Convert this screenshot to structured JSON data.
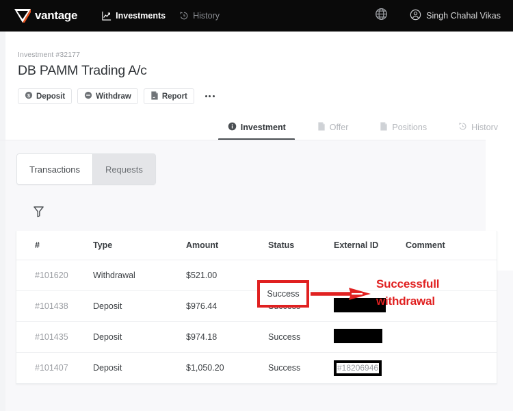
{
  "brand": {
    "name": "vantage",
    "logo_icon": "vantage-v-mark",
    "accent": "#e8531f"
  },
  "topnav": {
    "links": [
      {
        "label": "Investments",
        "icon": "chart-line-icon",
        "active": true
      },
      {
        "label": "History",
        "icon": "clock-history-icon",
        "active": false
      }
    ],
    "globe_icon": "globe-icon",
    "user": {
      "name": "Singh Chahal Vikas",
      "icon": "user-circle-icon"
    }
  },
  "page": {
    "eyebrow": "Investment #32177",
    "title": "DB PAMM Trading A/c",
    "actions": [
      {
        "label": "Deposit",
        "icon": "dollar-circle-icon"
      },
      {
        "label": "Withdraw",
        "icon": "minus-circle-icon"
      },
      {
        "label": "Report",
        "icon": "document-icon"
      }
    ],
    "more_label": "More options"
  },
  "section_tabs": [
    {
      "label": "Investment",
      "icon": "info-circle-icon",
      "active": true
    },
    {
      "label": "Offer",
      "icon": "document-icon",
      "active": false
    },
    {
      "label": "Positions",
      "icon": "document-icon",
      "active": false
    },
    {
      "label": "History",
      "icon": "clock-history-icon",
      "active": false
    }
  ],
  "sub_tabs": [
    {
      "label": "Transactions",
      "active": true
    },
    {
      "label": "Requests",
      "active": false
    }
  ],
  "filter": {
    "icon": "filter-funnel-icon",
    "label": "Filter"
  },
  "table": {
    "columns": [
      "#",
      "Type",
      "Amount",
      "Status",
      "External ID",
      "Comment"
    ],
    "rows": [
      {
        "id": "#101620",
        "type": "Withdrawal",
        "amount": "$521.00",
        "status": "Success",
        "external_id": "",
        "external_id_style": "annotated-blank",
        "comment": ""
      },
      {
        "id": "#101438",
        "type": "Deposit",
        "amount": "$976.44",
        "status": "Success",
        "external_id": "",
        "external_id_style": "redacted-wide",
        "comment": ""
      },
      {
        "id": "#101435",
        "type": "Deposit",
        "amount": "$974.18",
        "status": "Success",
        "external_id": "",
        "external_id_style": "redacted-narrow",
        "comment": ""
      },
      {
        "id": "#101407",
        "type": "Deposit",
        "amount": "$1,050.20",
        "status": "Success",
        "external_id": "#18206946",
        "external_id_style": "boxed",
        "comment": ""
      }
    ]
  },
  "annotation": {
    "highlight_value": "Success",
    "text_line1": "Successfull",
    "text_line2": "withdrawal",
    "color": "#e02020",
    "arrow_icon": "right-arrow-annotation"
  }
}
